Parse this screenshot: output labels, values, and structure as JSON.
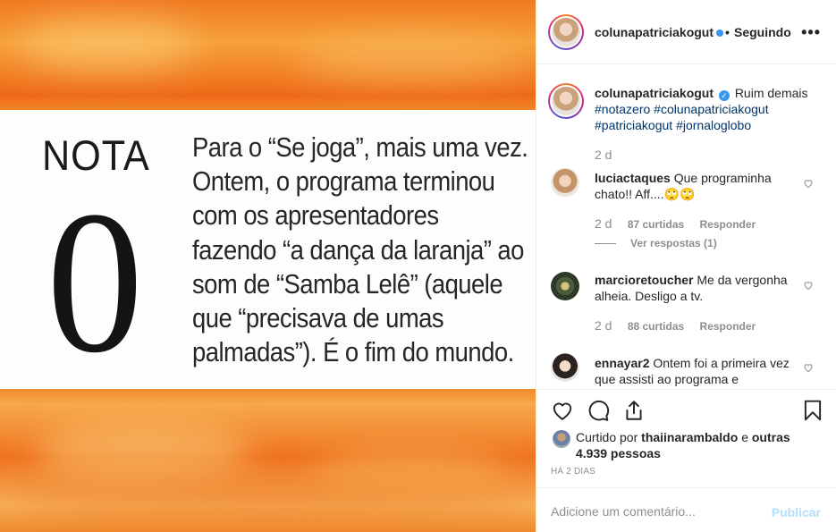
{
  "post": {
    "nota_label": "NOTA",
    "nota_value": "0",
    "quote_lines": [
      "Para o “Se joga”, mais uma vez.",
      "Ontem, o programa terminou",
      "com os apresentadores",
      "fazendo “a dança da laranja” ao",
      "som de “Samba Lelê” (aquele",
      "que “precisava de umas",
      "palmadas”). É o fim do mundo."
    ]
  },
  "header": {
    "username": "colunapatriciakogut",
    "separator": "•",
    "follow_status": "Seguindo",
    "more": "•••"
  },
  "caption": {
    "username": "colunapatriciakogut",
    "text": "Ruim demais",
    "hashtags": [
      "#notazero",
      "#colunapatriciakogut",
      "#patriciakogut",
      "#jornaloglobo"
    ],
    "time": "2 d"
  },
  "comments": [
    {
      "username": "luciactaques",
      "text": "Que programinha chato!! Aff....🙄🙄",
      "time": "2 d",
      "likes": "87 curtidas",
      "reply": "Responder",
      "view_replies": "Ver respostas (1)"
    },
    {
      "username": "marcioretoucher",
      "text": "Me da vergonha alheia. Desligo a tv.",
      "time": "2 d",
      "likes": "88 curtidas",
      "reply": "Responder"
    },
    {
      "username": "ennayar2",
      "text": "Ontem foi a primeira vez que assisti ao programa e"
    }
  ],
  "likes": {
    "prefix": "Curtido por",
    "user": "thaiinarambaldo",
    "conj": "e",
    "others": "outras 4.939 pessoas"
  },
  "posted_ago": "HÁ 2 DIAS",
  "add_comment": {
    "placeholder": "Adicione um comentário...",
    "publish": "Publicar"
  },
  "colors": {
    "accent_blue": "#3897f0",
    "publish_disabled": "#b2dffc",
    "muted": "#8e8e8e",
    "hashtag": "#003569"
  }
}
